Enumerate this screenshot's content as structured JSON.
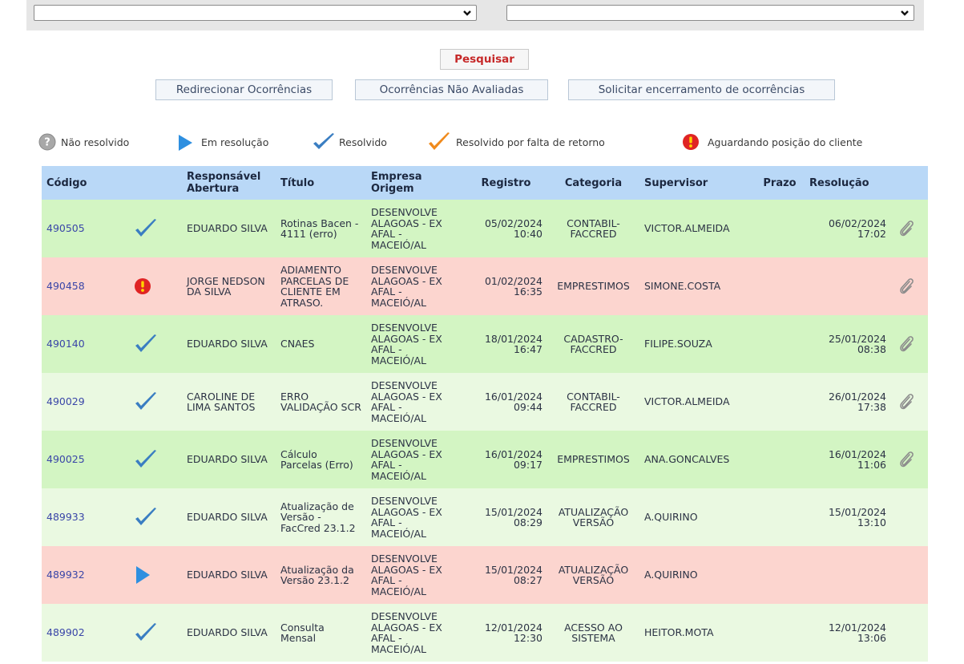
{
  "filters": {
    "select_left_value": "",
    "select_right_value": ""
  },
  "actions": {
    "search": "Pesquisar",
    "redirect": "Redirecionar Ocorrências",
    "not_evaluated": "Ocorrências Não Avaliadas",
    "request_close": "Solicitar encerramento de ocorrências"
  },
  "legend": {
    "not_resolved": "Não resolvido",
    "in_progress": "Em resolução",
    "resolved": "Resolvido",
    "resolved_no_return": "Resolvido por falta de retorno",
    "awaiting_client": "Aguardando posição do cliente"
  },
  "table": {
    "headers": {
      "code": "Código",
      "opener": "Responsável Abertura",
      "title": "Título",
      "company": "Empresa Origem",
      "registered": "Registro",
      "category": "Categoria",
      "supervisor": "Supervisor",
      "deadline": "Prazo",
      "resolution": "Resolução"
    },
    "rows": [
      {
        "code": "490505",
        "status": "resolved",
        "status_icon": "check-icon",
        "opener": "EDUARDO SILVA",
        "title": "Rotinas Bacen - 4111 (erro)",
        "company": "DESENVOLVE ALAGOAS - EX AFAL - MACEIÓ/AL",
        "registered_date": "05/02/2024",
        "registered_time": "10:40",
        "category": "CONTABIL-FACCRED",
        "supervisor": "VICTOR.ALMEIDA",
        "deadline": "",
        "resolution_date": "06/02/2024",
        "resolution_time": "17:02",
        "row_color": "#d3f5c3"
      },
      {
        "code": "490458",
        "status": "awaiting_client",
        "status_icon": "alert-icon",
        "opener": "JORGE NEDSON DA SILVA",
        "title": "ADIAMENTO PARCELAS DE CLIENTE EM ATRASO.",
        "company": "DESENVOLVE ALAGOAS - EX AFAL - MACEIÓ/AL",
        "registered_date": "01/02/2024",
        "registered_time": "16:35",
        "category": "EMPRESTIMOS",
        "supervisor": "SIMONE.COSTA",
        "deadline": "",
        "resolution_date": "",
        "resolution_time": "",
        "row_color": "#fcd5cf"
      },
      {
        "code": "490140",
        "status": "resolved",
        "status_icon": "check-icon",
        "opener": "EDUARDO SILVA",
        "title": "CNAES",
        "company": "DESENVOLVE ALAGOAS - EX AFAL - MACEIÓ/AL",
        "registered_date": "18/01/2024",
        "registered_time": "16:47",
        "category": "CADASTRO-FACCRED",
        "supervisor": "FILIPE.SOUZA",
        "deadline": "",
        "resolution_date": "25/01/2024",
        "resolution_time": "08:38",
        "row_color": "#d3f5c3"
      },
      {
        "code": "490029",
        "status": "resolved",
        "status_icon": "check-icon",
        "opener": "CAROLINE DE LIMA SANTOS",
        "title": "ERRO VALIDAÇÃO SCR",
        "company": "DESENVOLVE ALAGOAS - EX AFAL - MACEIÓ/AL",
        "registered_date": "16/01/2024",
        "registered_time": "09:44",
        "category": "CONTABIL-FACCRED",
        "supervisor": "VICTOR.ALMEIDA",
        "deadline": "",
        "resolution_date": "26/01/2024",
        "resolution_time": "17:38",
        "row_color": "#eaf9e1"
      },
      {
        "code": "490025",
        "status": "resolved",
        "status_icon": "check-icon",
        "opener": "EDUARDO SILVA",
        "title": "Cálculo Parcelas (Erro)",
        "company": "DESENVOLVE ALAGOAS - EX AFAL - MACEIÓ/AL",
        "registered_date": "16/01/2024",
        "registered_time": "09:17",
        "category": "EMPRESTIMOS",
        "supervisor": "ANA.GONCALVES",
        "deadline": "",
        "resolution_date": "16/01/2024",
        "resolution_time": "11:06",
        "row_color": "#d3f5c3"
      },
      {
        "code": "489933",
        "status": "resolved",
        "status_icon": "check-icon",
        "opener": "EDUARDO SILVA",
        "title": "Atualização de Versão - FacCred 23.1.2",
        "company": "DESENVOLVE ALAGOAS - EX AFAL - MACEIÓ/AL",
        "registered_date": "15/01/2024",
        "registered_time": "08:29",
        "category": "ATUALIZAÇÃO VERSÃO",
        "supervisor": "A.QUIRINO",
        "deadline": "",
        "resolution_date": "15/01/2024",
        "resolution_time": "13:10",
        "row_color": "#eaf9e1"
      },
      {
        "code": "489932",
        "status": "in_progress",
        "status_icon": "play-icon",
        "opener": "EDUARDO SILVA",
        "title": "Atualização da Versão 23.1.2",
        "company": "DESENVOLVE ALAGOAS - EX AFAL - MACEIÓ/AL",
        "registered_date": "15/01/2024",
        "registered_time": "08:27",
        "category": "ATUALIZAÇÃO VERSÃO",
        "supervisor": "A.QUIRINO",
        "deadline": "",
        "resolution_date": "",
        "resolution_time": "",
        "row_color": "#fcd5cf"
      },
      {
        "code": "489902",
        "status": "resolved",
        "status_icon": "check-icon",
        "opener": "EDUARDO SILVA",
        "title": "Consulta Mensal",
        "company": "DESENVOLVE ALAGOAS - EX AFAL - MACEIÓ/AL",
        "registered_date": "12/01/2024",
        "registered_time": "12:30",
        "category": "ACESSO AO SISTEMA",
        "supervisor": "HEITOR.MOTA",
        "deadline": "",
        "resolution_date": "12/01/2024",
        "resolution_time": "13:06",
        "row_color": "#eaf9e1"
      }
    ]
  }
}
